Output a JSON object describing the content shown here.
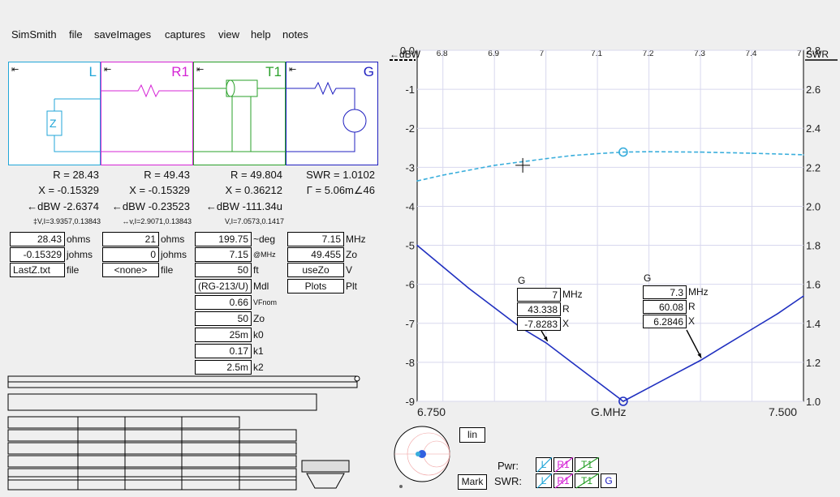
{
  "menu": [
    "SimSmith",
    "file",
    "saveImages",
    "captures",
    "view",
    "help",
    "notes"
  ],
  "elements": [
    {
      "name": "L",
      "color": "#21a6d8"
    },
    {
      "name": "R1",
      "color": "#d524d5"
    },
    {
      "name": "T1",
      "color": "#2aa02a"
    },
    {
      "name": "G",
      "color": "#2020c0"
    }
  ],
  "readouts": {
    "L": {
      "r": "R = 28.43",
      "x": "X = -0.15329",
      "dbw": "←dBW -2.6374",
      "vi": "‡V,I=3.9357,0.13843"
    },
    "R1": {
      "r": "R = 49.43",
      "x": "X = -0.15329",
      "dbw": "←dBW -0.23523",
      "vi": "↔v,I=2.9071,0.13843"
    },
    "T1": {
      "r": "R = 49.804",
      "x": "X = 0.36212",
      "dbw": "←dBW -111.34u",
      "vi": "V,I=7.0573,0.1417"
    },
    "G": {
      "swr": "SWR = 1.0102",
      "gamma": "Γ = 5.06m∠46"
    }
  },
  "params": {
    "L": [
      {
        "value": "28.43",
        "unit": "ohms"
      },
      {
        "value": "-0.15329",
        "unit": "johms"
      },
      {
        "value": "LastZ.txt",
        "unit": "file"
      }
    ],
    "R1": [
      {
        "value": "21",
        "unit": "ohms"
      },
      {
        "value": "0",
        "unit": "johms"
      },
      {
        "value": "<none>",
        "unit": "file"
      }
    ],
    "T1": [
      {
        "value": "199.75",
        "unit": "~deg"
      },
      {
        "value": "7.15",
        "unit": "@MHz"
      },
      {
        "value": "50",
        "unit": "ft"
      },
      {
        "value": "(RG-213/U)",
        "unit": "Mdl"
      },
      {
        "value": "0.66",
        "unit": "VFnom"
      },
      {
        "value": "50",
        "unit": "Zo"
      },
      {
        "value": "25m",
        "unit": "k0"
      },
      {
        "value": "0.17",
        "unit": "k1"
      },
      {
        "value": "2.5m",
        "unit": "k2"
      }
    ],
    "G": [
      {
        "value": "7.15",
        "unit": "MHz"
      },
      {
        "value": "49.455",
        "unit": "Zo"
      },
      {
        "value": "useZo",
        "unit": "V"
      },
      {
        "value": "Plots",
        "unit": "Plt"
      }
    ]
  },
  "chart_data": {
    "type": "line",
    "xlabel": "G.MHz",
    "x_range": [
      6.75,
      7.5
    ],
    "x_tick_labels": [
      "6.750",
      "G.MHz",
      "7.500"
    ],
    "top_tick_labels": [
      "6.8",
      "6.9",
      "7",
      "7.1",
      "7.2",
      "7.3",
      "7.4",
      "7"
    ],
    "top_tick_values": [
      6.8,
      6.9,
      7.0,
      7.1,
      7.2,
      7.3,
      7.4,
      7.5
    ],
    "left_axis_label": "←dBW",
    "right_axis_label": "SWR",
    "left_ylim": [
      -9,
      0
    ],
    "left_ticks": [
      "0.0",
      "-1",
      "-2",
      "-3",
      "-4",
      "-5",
      "-6",
      "-7",
      "-8",
      "-9"
    ],
    "right_ylim": [
      1.0,
      2.8
    ],
    "right_ticks": [
      "2.8",
      "2.6",
      "2.4",
      "2.2",
      "2.0",
      "1.8",
      "1.6",
      "1.4",
      "1.2",
      "1.0"
    ],
    "series": [
      {
        "axis": "left",
        "color": "#3aaedc",
        "dashed": true,
        "x": [
          6.75,
          6.8,
          6.9,
          7.0,
          7.05,
          7.1,
          7.15,
          7.2,
          7.3,
          7.4,
          7.5
        ],
        "y": [
          -3.35,
          -3.2,
          -2.95,
          -2.78,
          -2.7,
          -2.65,
          -2.61,
          -2.6,
          -2.61,
          -2.64,
          -2.68
        ]
      },
      {
        "axis": "right",
        "color": "#2030c0",
        "dashed": false,
        "x": [
          6.75,
          6.8,
          6.85,
          6.9,
          6.95,
          7.0,
          7.05,
          7.1,
          7.15,
          7.2,
          7.25,
          7.3,
          7.35,
          7.4,
          7.45,
          7.5
        ],
        "y": [
          1.8,
          1.69,
          1.58,
          1.48,
          1.38,
          1.3,
          1.2,
          1.1,
          1.0,
          1.07,
          1.14,
          1.21,
          1.29,
          1.37,
          1.45,
          1.54
        ]
      }
    ],
    "markers": [
      {
        "label": "G",
        "freq": "7",
        "freq_unit": "MHz",
        "r": "43.338",
        "r_unit": "R",
        "x": "-7.8283",
        "x_unit": "X"
      },
      {
        "label": "G",
        "freq": "7.3",
        "freq_unit": "MHz",
        "r": "60.08",
        "r_unit": "R",
        "x": "6.2846",
        "x_unit": "X"
      }
    ]
  },
  "bottom": {
    "lin": "lin",
    "mark": "Mark",
    "pwr": "Pwr:",
    "swr": "SWR:",
    "legend": [
      "L",
      "R1",
      "T1",
      "G"
    ]
  }
}
